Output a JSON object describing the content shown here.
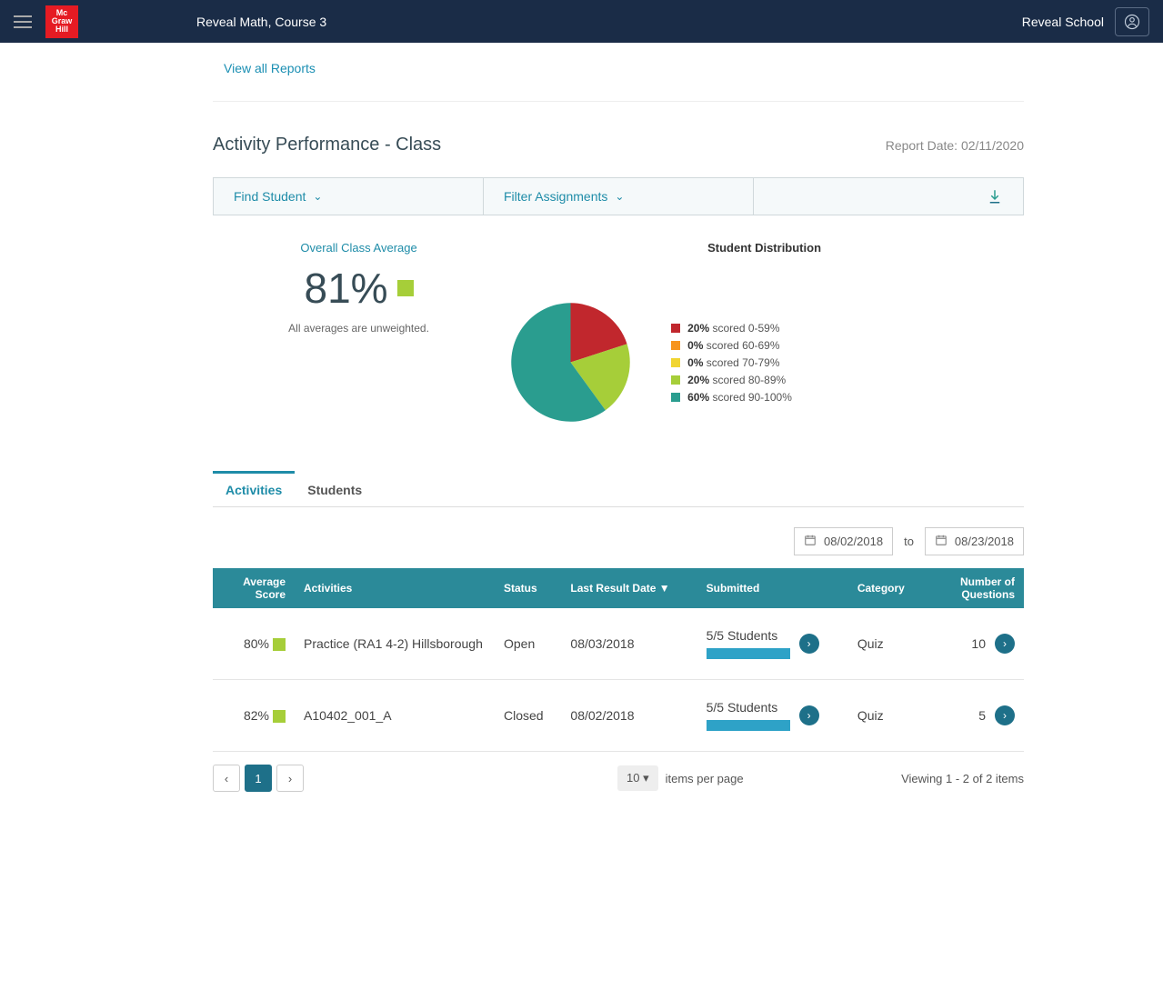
{
  "header": {
    "course_title": "Reveal Math, Course 3",
    "school_name": "Reveal School",
    "logo_lines": [
      "Mc",
      "Graw",
      "Hill"
    ]
  },
  "links": {
    "view_all_reports": "View all Reports"
  },
  "page": {
    "title": "Activity Performance - Class",
    "report_date": "Report Date: 02/11/2020"
  },
  "filters": {
    "find_student": "Find Student",
    "filter_assignments": "Filter Assignments"
  },
  "summary": {
    "avg_label": "Overall Class Average",
    "avg_value": "81%",
    "avg_note": "All averages are unweighted.",
    "dist_title": "Student Distribution"
  },
  "chart_data": {
    "type": "pie",
    "title": "Student Distribution",
    "series": [
      {
        "name": "scored 0-59%",
        "value": 20,
        "color": "#c1272d"
      },
      {
        "name": "scored 60-69%",
        "value": 0,
        "color": "#f7941e"
      },
      {
        "name": "scored 70-79%",
        "value": 0,
        "color": "#f1d531"
      },
      {
        "name": "scored 80-89%",
        "value": 20,
        "color": "#a6ce39"
      },
      {
        "name": "scored 90-100%",
        "value": 60,
        "color": "#2a9d8f"
      }
    ]
  },
  "tabs": {
    "activities": "Activities",
    "students": "Students"
  },
  "dates": {
    "from": "08/02/2018",
    "to_label": "to",
    "to": "08/23/2018"
  },
  "table": {
    "headers": {
      "avg_score": "Average Score",
      "activities": "Activities",
      "status": "Status",
      "last_result": "Last Result Date ▼",
      "submitted": "Submitted",
      "category": "Category",
      "num_questions": "Number of Questions"
    },
    "rows": [
      {
        "score": "80%",
        "activity": "Practice (RA1 4-2) Hillsborough",
        "status": "Open",
        "date": "08/03/2018",
        "submitted": "5/5 Students",
        "category": "Quiz",
        "questions": "10"
      },
      {
        "score": "82%",
        "activity": "A10402_001_A",
        "status": "Closed",
        "date": "08/02/2018",
        "submitted": "5/5 Students",
        "category": "Quiz",
        "questions": "5"
      }
    ]
  },
  "pagination": {
    "page": "1",
    "ipp": "10 ▾",
    "ipp_label": "items per page",
    "viewing": "Viewing 1 - 2 of 2 items"
  }
}
